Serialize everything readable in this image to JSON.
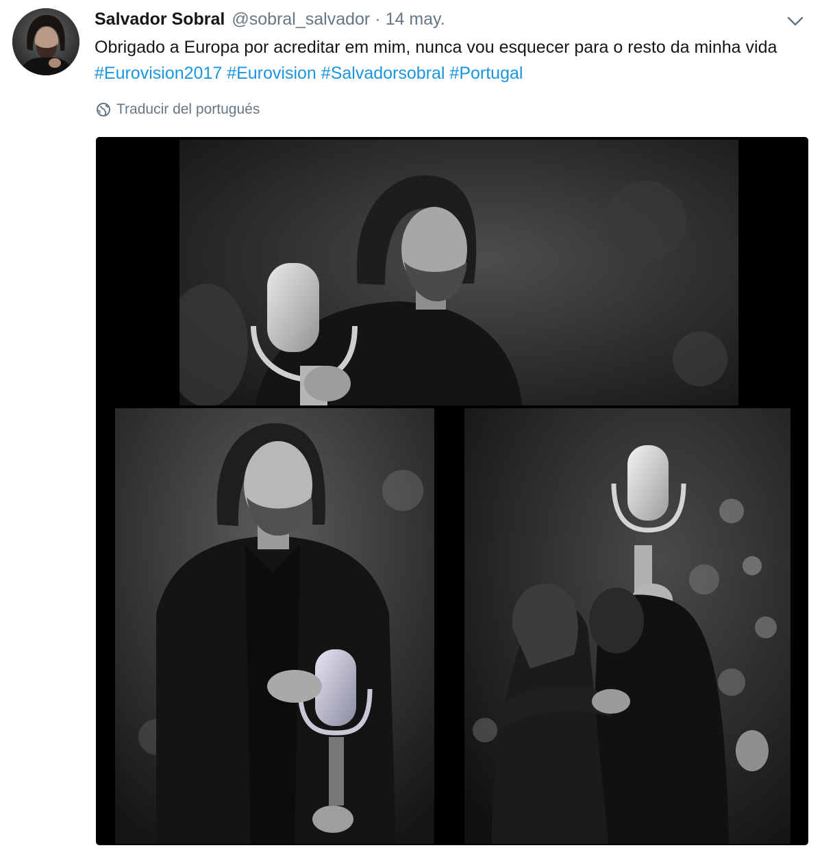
{
  "tweet": {
    "author_name": "Salvador Sobral",
    "handle": "@sobral_salvador",
    "separator": "·",
    "date": "14 may.",
    "text_plain": "Obrigado a Europa por acreditar em mim, nunca vou esquecer para o resto da minha vida",
    "hashtags": [
      "#Eurovision2017",
      "#Eurovision",
      "#Salvadorsobral",
      "#Portugal"
    ],
    "translate_label": "Traducir del portugués",
    "icons": {
      "menu": "chevron-down-icon",
      "translate": "globe-icon"
    },
    "colors": {
      "link": "#1b95e0",
      "secondary_text": "#657786",
      "primary_text": "#14171a"
    }
  }
}
